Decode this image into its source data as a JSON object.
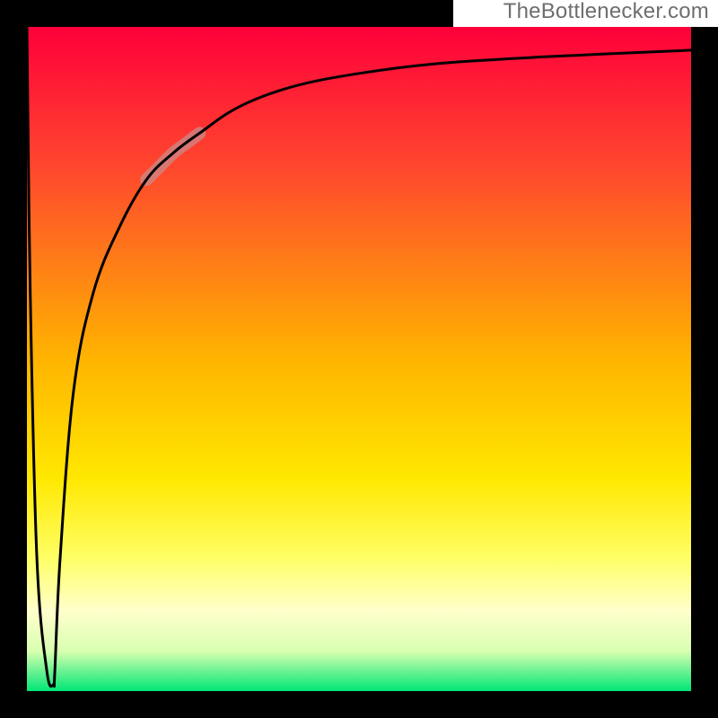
{
  "attribution": "TheBottlenecker.com",
  "chart_data": {
    "type": "line",
    "title": "",
    "xlabel": "",
    "ylabel": "",
    "xlim": [
      0,
      100
    ],
    "ylim": [
      0,
      100
    ],
    "notes": "No numeric axis labels are visible; values are fractional positions read from the plot area. Y is plotted so higher curve = higher bottleneck; background gradient encodes vertical position (red top → green bottom).",
    "background_gradient_stops": [
      {
        "pos": 0.0,
        "color": "#ff003a"
      },
      {
        "pos": 0.22,
        "color": "#ff4a2d"
      },
      {
        "pos": 0.5,
        "color": "#ffb400"
      },
      {
        "pos": 0.68,
        "color": "#ffe800"
      },
      {
        "pos": 0.8,
        "color": "#ffff66"
      },
      {
        "pos": 0.88,
        "color": "#ffffcc"
      },
      {
        "pos": 0.94,
        "color": "#d8ffb0"
      },
      {
        "pos": 1.0,
        "color": "#00e676"
      }
    ],
    "series": [
      {
        "name": "bottleneck-curve",
        "color": "#000000",
        "x": [
          0.0,
          0.5,
          1.5,
          3.0,
          4.0,
          4.2,
          5.0,
          7.0,
          10.0,
          14.0,
          18.0,
          22.0,
          26.0,
          32.0,
          40.0,
          50.0,
          62.0,
          78.0,
          100.0
        ],
        "y": [
          100.0,
          60.0,
          20.0,
          3.0,
          1.0,
          3.0,
          20.0,
          45.0,
          60.0,
          70.0,
          77.0,
          81.0,
          84.0,
          88.0,
          91.0,
          93.0,
          94.5,
          95.5,
          96.5
        ]
      }
    ],
    "highlight_segment": {
      "name": "highlighted-range",
      "color": "#c98a8a",
      "opacity": 0.75,
      "x": [
        18.0,
        20.0,
        22.0,
        24.0,
        26.0
      ],
      "y": [
        77.0,
        79.0,
        81.0,
        82.5,
        84.0
      ]
    }
  }
}
